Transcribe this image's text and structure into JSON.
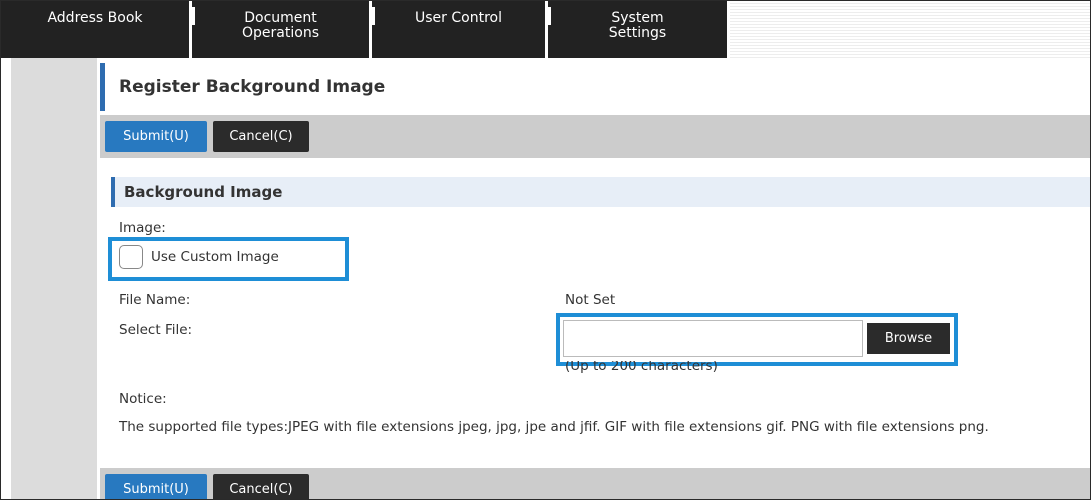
{
  "tabs": [
    {
      "label": "Address Book"
    },
    {
      "label": "Document\nOperations"
    },
    {
      "label": "User Control"
    },
    {
      "label": "System\nSettings"
    }
  ],
  "page": {
    "title": "Register Background Image"
  },
  "toolbar": {
    "submit_label": "Submit(U)",
    "cancel_label": "Cancel(C)"
  },
  "section": {
    "title": "Background Image"
  },
  "form": {
    "image_label": "Image:",
    "use_custom_label": "Use Custom Image",
    "use_custom_checked": false,
    "file_name_label": "File Name:",
    "file_name_value": "Not Set",
    "select_file_label": "Select File:",
    "select_file_value": "",
    "browse_label": "Browse",
    "limit_hint": "(Up to 200 characters)",
    "notice_label": "Notice:",
    "notice_text": "The supported file types:JPEG with file extensions jpeg, jpg, jpe and jfif. GIF with file extensions gif. PNG with file extensions png."
  },
  "colors": {
    "accent": "#2e6cb0",
    "submit": "#2879c0",
    "highlight": "#1e8ed6",
    "tab_bg": "#222222"
  }
}
